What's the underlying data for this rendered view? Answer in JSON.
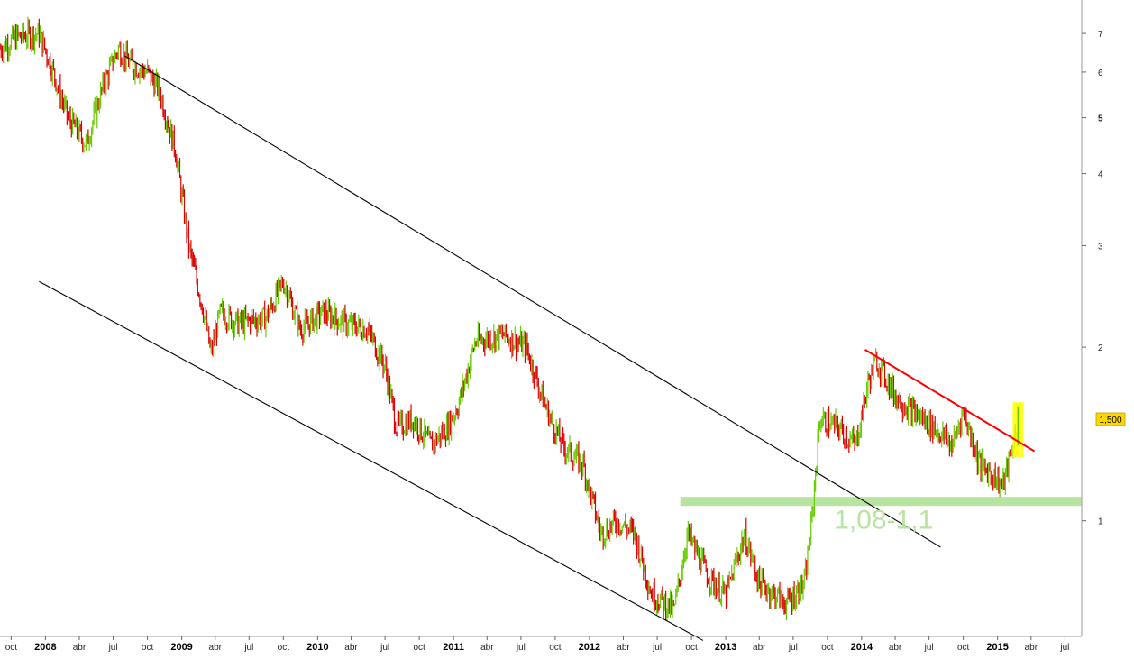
{
  "chart_data": {
    "type": "ohlc",
    "title": "",
    "y_scale": "log",
    "ylim": [
      0.63,
      8.0
    ],
    "xlim": [
      "2007-09-01",
      "2015-08-15"
    ],
    "grid": false,
    "x_ticks": [
      {
        "label": "oct",
        "date": "2007-10-01",
        "year": false
      },
      {
        "label": "2008",
        "date": "2008-01-01",
        "year": true
      },
      {
        "label": "abr",
        "date": "2008-04-01",
        "year": false
      },
      {
        "label": "jul",
        "date": "2008-07-01",
        "year": false
      },
      {
        "label": "oct",
        "date": "2008-10-01",
        "year": false
      },
      {
        "label": "2009",
        "date": "2009-01-01",
        "year": true
      },
      {
        "label": "abr",
        "date": "2009-04-01",
        "year": false
      },
      {
        "label": "jul",
        "date": "2009-07-01",
        "year": false
      },
      {
        "label": "oct",
        "date": "2009-10-01",
        "year": false
      },
      {
        "label": "2010",
        "date": "2010-01-01",
        "year": true
      },
      {
        "label": "abr",
        "date": "2010-04-01",
        "year": false
      },
      {
        "label": "jul",
        "date": "2010-07-01",
        "year": false
      },
      {
        "label": "oct",
        "date": "2010-10-01",
        "year": false
      },
      {
        "label": "2011",
        "date": "2011-01-01",
        "year": true
      },
      {
        "label": "abr",
        "date": "2011-04-01",
        "year": false
      },
      {
        "label": "jul",
        "date": "2011-07-01",
        "year": false
      },
      {
        "label": "oct",
        "date": "2011-10-01",
        "year": false
      },
      {
        "label": "2012",
        "date": "2012-01-01",
        "year": true
      },
      {
        "label": "abr",
        "date": "2012-04-01",
        "year": false
      },
      {
        "label": "jul",
        "date": "2012-07-01",
        "year": false
      },
      {
        "label": "oct",
        "date": "2012-10-01",
        "year": false
      },
      {
        "label": "2013",
        "date": "2013-01-01",
        "year": true
      },
      {
        "label": "abr",
        "date": "2013-04-01",
        "year": false
      },
      {
        "label": "jul",
        "date": "2013-07-01",
        "year": false
      },
      {
        "label": "oct",
        "date": "2013-10-01",
        "year": false
      },
      {
        "label": "2014",
        "date": "2014-01-01",
        "year": true
      },
      {
        "label": "abr",
        "date": "2014-04-01",
        "year": false
      },
      {
        "label": "jul",
        "date": "2014-07-01",
        "year": false
      },
      {
        "label": "oct",
        "date": "2014-10-01",
        "year": false
      },
      {
        "label": "2015",
        "date": "2015-01-01",
        "year": true
      },
      {
        "label": "abr",
        "date": "2015-04-01",
        "year": false
      },
      {
        "label": "jul",
        "date": "2015-07-01",
        "year": false
      }
    ],
    "y_ticks": [
      {
        "label": "7",
        "value": 7,
        "bold": false
      },
      {
        "label": "6",
        "value": 6,
        "bold": false
      },
      {
        "label": "5",
        "value": 5,
        "bold": true
      },
      {
        "label": "4",
        "value": 4,
        "bold": false
      },
      {
        "label": "3",
        "value": 3,
        "bold": false
      },
      {
        "label": "2",
        "value": 2,
        "bold": false
      },
      {
        "label": "1",
        "value": 1,
        "bold": false
      }
    ],
    "price_path": [
      [
        "2007-09-01",
        6.6
      ],
      [
        "2007-10-15",
        6.9
      ],
      [
        "2007-12-15",
        7.0
      ],
      [
        "2008-01-15",
        6.2
      ],
      [
        "2008-03-01",
        5.0
      ],
      [
        "2008-04-20",
        4.5
      ],
      [
        "2008-06-01",
        5.6
      ],
      [
        "2008-07-15",
        6.6
      ],
      [
        "2008-08-15",
        6.2
      ],
      [
        "2008-10-01",
        6.0
      ],
      [
        "2008-11-01",
        5.6
      ],
      [
        "2008-12-15",
        4.4
      ],
      [
        "2009-01-20",
        3.0
      ],
      [
        "2009-03-01",
        2.3
      ],
      [
        "2009-03-20",
        1.95
      ],
      [
        "2009-04-15",
        2.3
      ],
      [
        "2009-06-01",
        2.2
      ],
      [
        "2009-08-15",
        2.25
      ],
      [
        "2009-10-01",
        2.6
      ],
      [
        "2009-11-15",
        2.15
      ],
      [
        "2010-01-15",
        2.3
      ],
      [
        "2010-03-15",
        2.2
      ],
      [
        "2010-05-15",
        2.15
      ],
      [
        "2010-07-01",
        1.85
      ],
      [
        "2010-08-01",
        1.45
      ],
      [
        "2010-09-15",
        1.5
      ],
      [
        "2010-11-01",
        1.35
      ],
      [
        "2010-12-15",
        1.45
      ],
      [
        "2011-01-15",
        1.6
      ],
      [
        "2011-03-01",
        2.05
      ],
      [
        "2011-05-15",
        2.1
      ],
      [
        "2011-07-15",
        2.0
      ],
      [
        "2011-09-01",
        1.6
      ],
      [
        "2011-10-20",
        1.35
      ],
      [
        "2011-12-15",
        1.25
      ],
      [
        "2012-02-01",
        0.95
      ],
      [
        "2012-03-15",
        1.0
      ],
      [
        "2012-05-01",
        0.95
      ],
      [
        "2012-06-15",
        0.75
      ],
      [
        "2012-08-15",
        0.7
      ],
      [
        "2012-09-20",
        0.95
      ],
      [
        "2012-11-15",
        0.8
      ],
      [
        "2013-01-01",
        0.74
      ],
      [
        "2013-02-20",
        0.95
      ],
      [
        "2013-04-01",
        0.78
      ],
      [
        "2013-06-15",
        0.72
      ],
      [
        "2013-08-01",
        0.78
      ],
      [
        "2013-08-20",
        1.0
      ],
      [
        "2013-09-10",
        1.5
      ],
      [
        "2013-11-01",
        1.45
      ],
      [
        "2013-12-15",
        1.35
      ],
      [
        "2014-01-20",
        1.75
      ],
      [
        "2014-02-10",
        1.9
      ],
      [
        "2014-04-01",
        1.65
      ],
      [
        "2014-05-15",
        1.55
      ],
      [
        "2014-07-15",
        1.45
      ],
      [
        "2014-09-01",
        1.35
      ],
      [
        "2014-10-01",
        1.55
      ],
      [
        "2014-11-15",
        1.25
      ],
      [
        "2014-12-20",
        1.2
      ],
      [
        "2015-01-15",
        1.15
      ],
      [
        "2015-02-05",
        1.3
      ],
      [
        "2015-02-25",
        1.52
      ]
    ],
    "trendlines": [
      {
        "name": "channel-upper",
        "color": "#000000",
        "from": [
          "2008-08-01",
          6.4
        ],
        "to": [
          "2014-08-01",
          0.9
        ]
      },
      {
        "name": "channel-lower",
        "color": "#000000",
        "from": [
          "2007-12-15",
          2.6
        ],
        "to": [
          "2012-11-01",
          0.62
        ]
      },
      {
        "name": "resistance",
        "color": "#ff0000",
        "from": [
          "2014-01-10",
          1.98
        ],
        "to": [
          "2015-04-10",
          1.32
        ]
      }
    ],
    "support_zone": {
      "from": "2012-09-01",
      "to": "2015-08-15",
      "ymin": 1.08,
      "ymax": 1.1,
      "color": "#b7e4a0",
      "label": "1,08-1,1"
    },
    "highlight_bar": {
      "date": "2015-02-25",
      "color": "#ffff00"
    },
    "last_price_label": "1,500",
    "last_price": 1.5,
    "up_color": "#66cc00",
    "down_color": "#dd0000"
  }
}
